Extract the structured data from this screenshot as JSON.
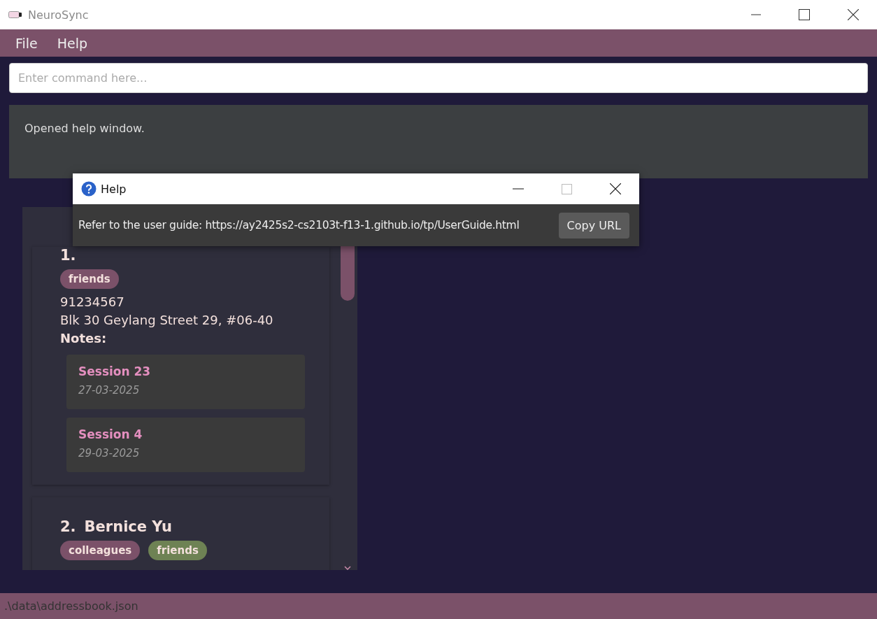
{
  "window": {
    "title": "NeuroSync"
  },
  "menu": [
    "File",
    "Help"
  ],
  "command": {
    "placeholder": "Enter command here..."
  },
  "result": "Opened help window.",
  "persons": [
    {
      "index": "1.",
      "tags": [
        {
          "label": "friends",
          "color": "#7b5169"
        }
      ],
      "phone": "91234567",
      "address": "Blk 30 Geylang Street 29, #06-40",
      "notes_label": "Notes:",
      "notes": [
        {
          "title": "Session 23",
          "date": "27-03-2025"
        },
        {
          "title": "Session 4",
          "date": "29-03-2025"
        }
      ]
    },
    {
      "index": "2.",
      "name": "Bernice Yu",
      "tags": [
        {
          "label": "colleagues",
          "color": "#7b5169"
        },
        {
          "label": "friends",
          "color": "#6e8254"
        }
      ]
    }
  ],
  "status_bar": ".\\data\\addressbook.json",
  "help_dialog": {
    "title": "Help",
    "message": "Refer to the user guide: https://ay2425s2-cs2103t-f13-1.github.io/tp/UserGuide.html",
    "button": "Copy URL"
  }
}
